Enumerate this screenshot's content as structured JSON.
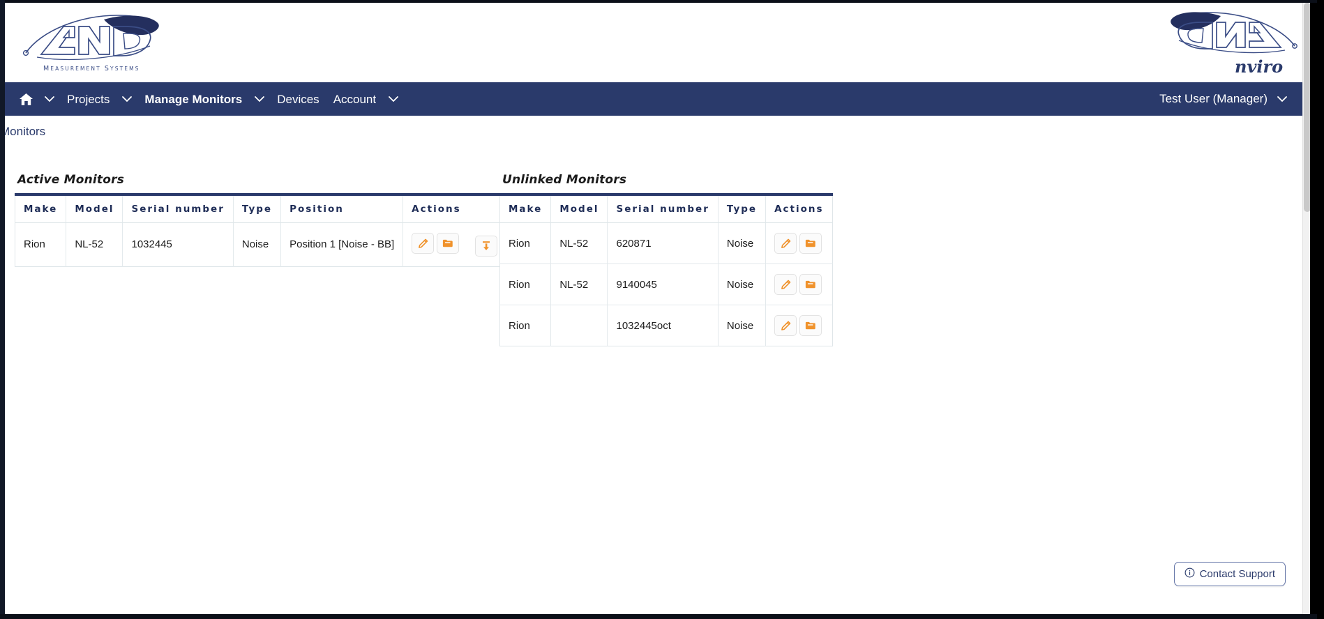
{
  "brand": {
    "left_logo_name": "ANV",
    "left_logo_tagline": "MEASUREMENT SYSTEMS",
    "right_logo_name": "ANV",
    "right_logo_tagline": "nviro"
  },
  "nav": {
    "home_label": "Home",
    "items": [
      {
        "label": "Projects",
        "bold": false,
        "caret": true
      },
      {
        "label": "Manage Monitors",
        "bold": true,
        "caret": true
      },
      {
        "label": "Devices",
        "bold": false,
        "caret": false
      },
      {
        "label": "Account",
        "bold": false,
        "caret": true
      }
    ],
    "user_label": "Test User (Manager)",
    "bg_color": "#2a3a6b"
  },
  "breadcrumb": {
    "label": "Monitors"
  },
  "panels": {
    "active": {
      "title": "Active Monitors",
      "columns": [
        "Make",
        "Model",
        "Serial number",
        "Type",
        "Position",
        "Actions"
      ],
      "rows": [
        {
          "make": "Rion",
          "model": "NL-52",
          "serial": "1032445",
          "type": "Noise",
          "position": "Position 1 [Noise - BB]",
          "actions": [
            "edit-icon",
            "folder-icon",
            "unlink-icon"
          ]
        }
      ]
    },
    "unlinked": {
      "title": "Unlinked Monitors",
      "columns": [
        "Make",
        "Model",
        "Serial number",
        "Type",
        "Actions"
      ],
      "rows": [
        {
          "make": "Rion",
          "model": "NL-52",
          "serial": "620871",
          "type": "Noise",
          "actions": [
            "edit-icon",
            "folder-icon"
          ]
        },
        {
          "make": "Rion",
          "model": "NL-52",
          "serial": "9140045",
          "type": "Noise",
          "actions": [
            "edit-icon",
            "folder-icon"
          ]
        },
        {
          "make": "Rion",
          "model": "",
          "serial": "1032445oct",
          "type": "Noise",
          "actions": [
            "edit-icon",
            "folder-icon"
          ]
        }
      ]
    }
  },
  "footer": {
    "contact_support_label": "Contact Support",
    "contact_support_icon": "info-icon"
  },
  "colors": {
    "navy": "#2a3a6b",
    "table_header_text": "#1f2d57",
    "action_orange": "#f0922b",
    "border_light": "#dfe6e9"
  }
}
